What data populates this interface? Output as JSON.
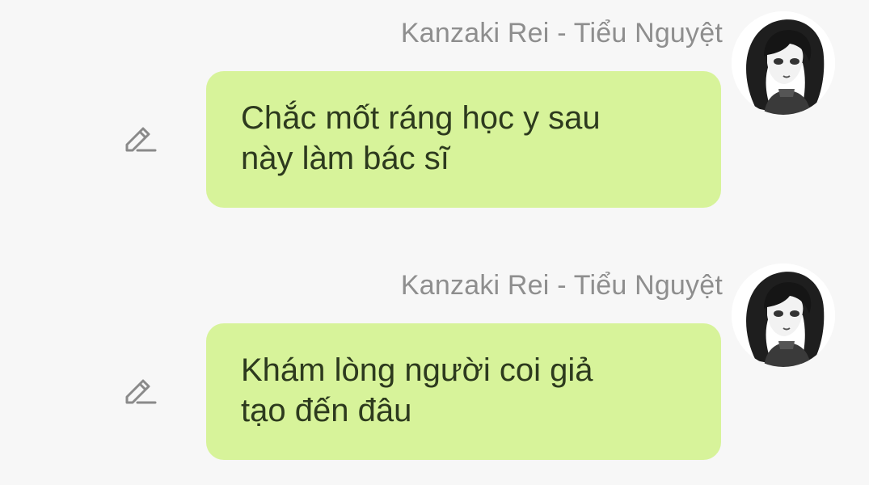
{
  "messages": [
    {
      "sender": "Kanzaki Rei - Tiểu Nguyệt",
      "lines": [
        "Chắc mốt ráng học y sau",
        "này làm bác sĩ"
      ]
    },
    {
      "sender": "Kanzaki Rei - Tiểu Nguyệt",
      "lines": [
        "Khám lòng người coi giả",
        "tạo đến đâu"
      ]
    }
  ],
  "colors": {
    "background": "#f7f7f7",
    "bubble": "#d7f39a",
    "sender_text": "#8e8e8e",
    "message_text": "#2d3a1e",
    "icon": "#8a8a8a"
  },
  "icons": {
    "edit": "pencil-icon",
    "avatar": "avatar"
  }
}
